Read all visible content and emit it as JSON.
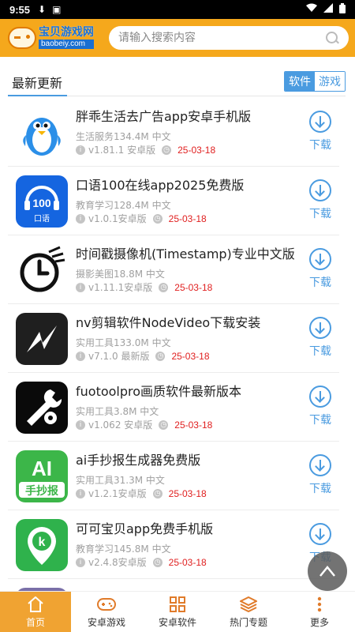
{
  "status_bar": {
    "time": "9:55"
  },
  "header": {
    "logo_text": "宝贝游戏网",
    "logo_domain": "baobeiy.com",
    "search_placeholder": "请输入搜索内容"
  },
  "section": {
    "title": "最新更新",
    "tabs": [
      {
        "label": "软件",
        "active": true
      },
      {
        "label": "游戏",
        "active": false
      }
    ]
  },
  "apps": [
    {
      "name": "胖乖生活去广告app安卓手机版",
      "category": "生活服务",
      "size": "134.4M",
      "lang": "中文",
      "version": "v1.81.1 安卓版",
      "date": "25-03-18",
      "download_label": "下载",
      "icon": "penguin-icon"
    },
    {
      "name": "口语100在线app2025免费版",
      "category": "教育学习",
      "size": "128.4M",
      "lang": "中文",
      "version": "v1.0.1安卓版",
      "date": "25-03-18",
      "download_label": "下载",
      "icon": "kouyu100-icon"
    },
    {
      "name": "时间戳摄像机(Timestamp)专业中文版",
      "category": "摄影美图",
      "size": "18.8M",
      "lang": "中文",
      "version": "v1.11.1安卓版",
      "date": "25-03-18",
      "download_label": "下载",
      "icon": "timestamp-clock-icon"
    },
    {
      "name": "nv剪辑软件NodeVideo下载安装",
      "category": "实用工具",
      "size": "133.0M",
      "lang": "中文",
      "version": "v7.1.0 最新版",
      "date": "25-03-18",
      "download_label": "下载",
      "icon": "nodevideo-icon"
    },
    {
      "name": "fuotoolpro画质软件最新版本",
      "category": "实用工具",
      "size": "3.8M",
      "lang": "中文",
      "version": "v1.062 安卓版",
      "date": "25-03-18",
      "download_label": "下载",
      "icon": "wrench-gear-icon"
    },
    {
      "name": "ai手抄报生成器免费版",
      "category": "实用工具",
      "size": "31.3M",
      "lang": "中文",
      "version": "v1.2.1安卓版",
      "date": "25-03-18",
      "download_label": "下载",
      "icon": "ai-shouchaobao-icon",
      "icon_text_1": "AI",
      "icon_text_2": "手抄报"
    },
    {
      "name": "可可宝贝app免费手机版",
      "category": "教育学习",
      "size": "145.8M",
      "lang": "中文",
      "version": "v2.4.8安卓版",
      "date": "25-03-18",
      "download_label": "下载",
      "icon": "keke-k-icon"
    }
  ],
  "bottom_nav": [
    {
      "label": "首页",
      "icon": "home-icon",
      "active": true
    },
    {
      "label": "安卓游戏",
      "icon": "gamepad-icon",
      "active": false
    },
    {
      "label": "安卓软件",
      "icon": "grid-icon",
      "active": false
    },
    {
      "label": "热门专题",
      "icon": "layers-icon",
      "active": false
    },
    {
      "label": "更多",
      "icon": "more-vertical-icon",
      "active": false
    }
  ],
  "colors": {
    "header": "#f5a81c",
    "accent_blue": "#4a9be0",
    "date_red": "#e02020",
    "active_tab": "#f0a332"
  }
}
